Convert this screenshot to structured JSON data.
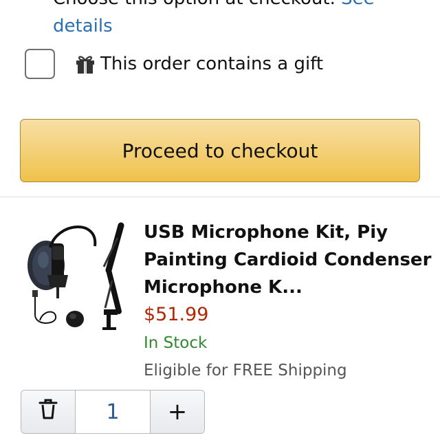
{
  "checkout_note": {
    "text": "Choose this option at checkout.",
    "link_label": "See details"
  },
  "gift": {
    "checked": false,
    "icon": "gift-icon",
    "label": "This order contains a gift"
  },
  "checkout_button": {
    "label": "Proceed to checkout",
    "color": "#f0c14b"
  },
  "cart_item": {
    "image": "usb-microphone-kit-image",
    "title": "USB Microphone Kit, Piy Painting Cardioid Condenser Microphone K...",
    "price": "$51.99",
    "stock": "In Stock",
    "shipping": "Eligible for FREE Shipping",
    "quantity": "1",
    "delete_icon": "trash-icon",
    "increment_label": "+"
  },
  "colors": {
    "price": "#b12704",
    "in_stock": "#2f8a2f",
    "link": "#2a6fb0"
  }
}
